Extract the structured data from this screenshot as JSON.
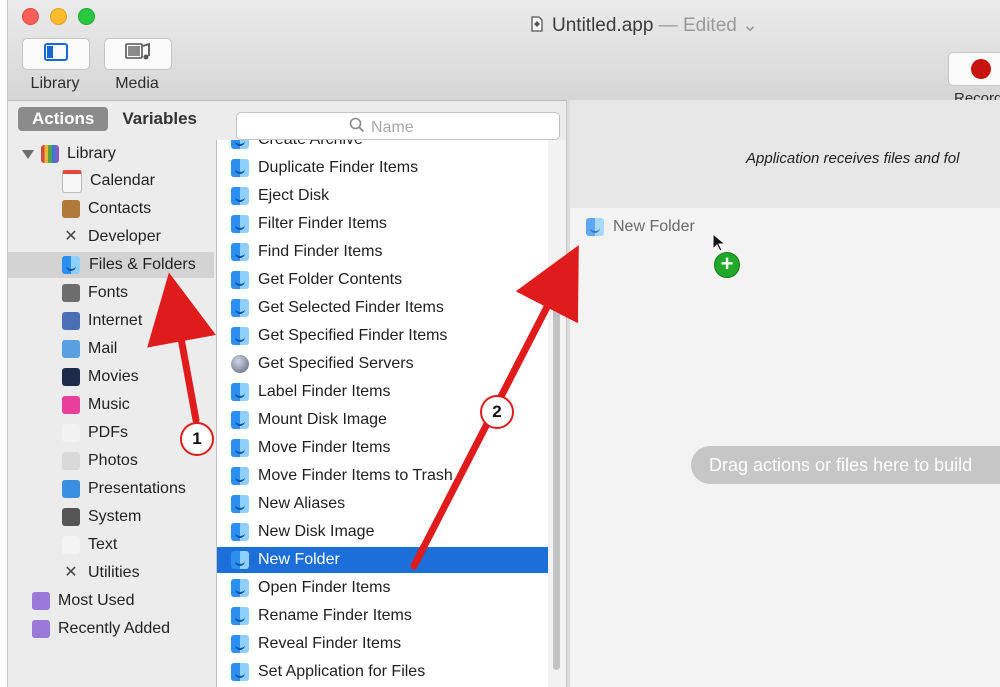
{
  "window": {
    "title": "Untitled.app",
    "edited_label": "— Edited",
    "edited_chevron": "⌄"
  },
  "toolbar": {
    "library_label": "Library",
    "media_label": "Media",
    "record_label": "Record"
  },
  "tabs": {
    "actions": "Actions",
    "variables": "Variables"
  },
  "search": {
    "placeholder": "Name"
  },
  "library": {
    "root": "Library",
    "items": [
      {
        "label": "Calendar",
        "icon": "calendar-icon",
        "selected": false
      },
      {
        "label": "Contacts",
        "icon": "contacts-icon",
        "selected": false
      },
      {
        "label": "Developer",
        "icon": "developer-icon",
        "selected": false
      },
      {
        "label": "Files & Folders",
        "icon": "files-folders-icon",
        "selected": true
      },
      {
        "label": "Fonts",
        "icon": "fonts-icon",
        "selected": false
      },
      {
        "label": "Internet",
        "icon": "internet-icon",
        "selected": false
      },
      {
        "label": "Mail",
        "icon": "mail-icon",
        "selected": false
      },
      {
        "label": "Movies",
        "icon": "movies-icon",
        "selected": false
      },
      {
        "label": "Music",
        "icon": "music-icon",
        "selected": false
      },
      {
        "label": "PDFs",
        "icon": "pdfs-icon",
        "selected": false
      },
      {
        "label": "Photos",
        "icon": "photos-icon",
        "selected": false
      },
      {
        "label": "Presentations",
        "icon": "presentations-icon",
        "selected": false
      },
      {
        "label": "System",
        "icon": "system-icon",
        "selected": false
      },
      {
        "label": "Text",
        "icon": "text-icon",
        "selected": false
      },
      {
        "label": "Utilities",
        "icon": "utilities-icon",
        "selected": false
      }
    ],
    "smart": [
      {
        "label": "Most Used",
        "icon": "smart-folder-icon"
      },
      {
        "label": "Recently Added",
        "icon": "smart-folder-icon"
      }
    ]
  },
  "actions": {
    "items": [
      {
        "label": "Create Archive",
        "icon": "finder-icon",
        "selected": false
      },
      {
        "label": "Duplicate Finder Items",
        "icon": "finder-icon",
        "selected": false
      },
      {
        "label": "Eject Disk",
        "icon": "finder-icon",
        "selected": false
      },
      {
        "label": "Filter Finder Items",
        "icon": "finder-icon",
        "selected": false
      },
      {
        "label": "Find Finder Items",
        "icon": "finder-icon",
        "selected": false
      },
      {
        "label": "Get Folder Contents",
        "icon": "finder-icon",
        "selected": false
      },
      {
        "label": "Get Selected Finder Items",
        "icon": "finder-icon",
        "selected": false
      },
      {
        "label": "Get Specified Finder Items",
        "icon": "finder-icon",
        "selected": false
      },
      {
        "label": "Get Specified Servers",
        "icon": "network-globe-icon",
        "selected": false
      },
      {
        "label": "Label Finder Items",
        "icon": "finder-icon",
        "selected": false
      },
      {
        "label": "Mount Disk Image",
        "icon": "finder-icon",
        "selected": false
      },
      {
        "label": "Move Finder Items",
        "icon": "finder-icon",
        "selected": false
      },
      {
        "label": "Move Finder Items to Trash",
        "icon": "finder-icon",
        "selected": false
      },
      {
        "label": "New Aliases",
        "icon": "finder-icon",
        "selected": false
      },
      {
        "label": "New Disk Image",
        "icon": "finder-icon",
        "selected": false
      },
      {
        "label": "New Folder",
        "icon": "finder-icon",
        "selected": true
      },
      {
        "label": "Open Finder Items",
        "icon": "finder-icon",
        "selected": false
      },
      {
        "label": "Rename Finder Items",
        "icon": "finder-icon",
        "selected": false
      },
      {
        "label": "Reveal Finder Items",
        "icon": "finder-icon",
        "selected": false
      },
      {
        "label": "Set Application for Files",
        "icon": "finder-icon",
        "selected": false
      }
    ]
  },
  "workflow": {
    "header_text": "Application receives files and fol",
    "dragged_item": "New Folder",
    "drag_hint": "Drag actions or files here to build"
  },
  "annotations": {
    "step1": "1",
    "step2": "2",
    "color": "#e01b1b"
  }
}
